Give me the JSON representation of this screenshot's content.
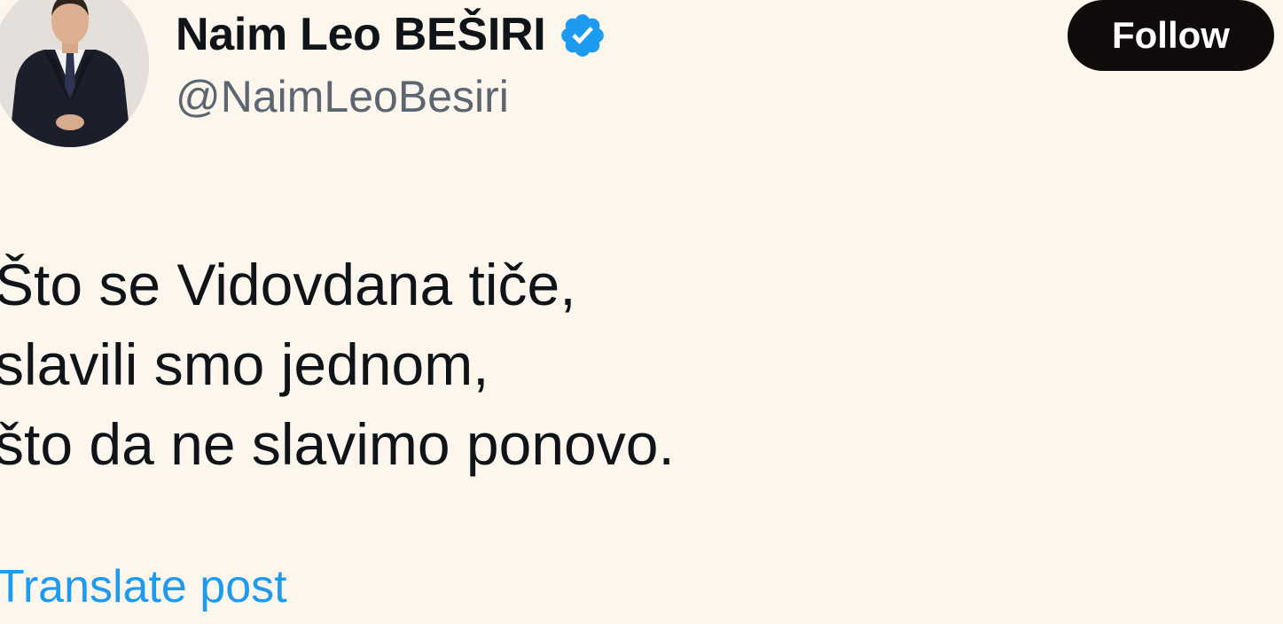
{
  "author": {
    "display_name": "Naim Leo BEŠIRI",
    "handle": "@NaimLeoBesiri",
    "verified": true,
    "verified_icon": "verified-badge-icon",
    "verified_color": "#1d9bf0"
  },
  "actions": {
    "follow_label": "Follow"
  },
  "post": {
    "lines": [
      "Što se Vidovdana tiče,",
      "slavili smo jednom,",
      "što da ne slavimo ponovo."
    ],
    "translate_label": "Translate post"
  },
  "colors": {
    "background": "#fdf6ec",
    "text": "#0f1419",
    "secondary_text": "#5b6670",
    "link": "#1d9bf0",
    "button_bg": "#0f0c0b"
  }
}
